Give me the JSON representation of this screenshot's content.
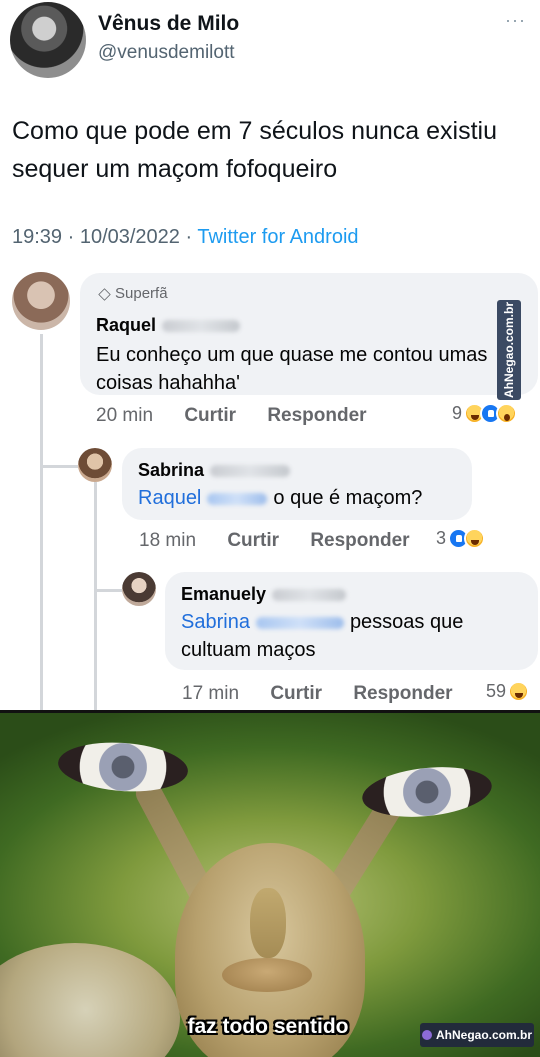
{
  "tweet": {
    "author_name": "Vênus de Milo",
    "author_handle": "@venusdemilott",
    "text": "Como que pode em 7 séculos nunca existiu sequer um maçom fofoqueiro",
    "timestamp": "19:39 · 10/03/2022 · ",
    "source": "Twitter for Android",
    "more_icon": "···"
  },
  "comments": [
    {
      "badge": "Superfã",
      "name": "Raquel",
      "text": "Eu conheço um que quase me contou umas coisas hahahha'",
      "time": "20 min",
      "like_label": "Curtir",
      "reply_label": "Responder",
      "reaction_count": "9",
      "reactions": [
        "haha-icon",
        "like-icon",
        "wow-icon"
      ]
    },
    {
      "name": "Sabrina",
      "mention": "Raquel",
      "text": "o que é maçom?",
      "time": "18 min",
      "like_label": "Curtir",
      "reply_label": "Responder",
      "reaction_count": "3",
      "reactions": [
        "like-icon",
        "haha-icon"
      ]
    },
    {
      "name": "Emanuely",
      "mention": "Sabrina",
      "text": "pessoas que cultuam maços",
      "time": "17 min",
      "like_label": "Curtir",
      "reply_label": "Responder",
      "reaction_count": "59",
      "reactions": [
        "haha-icon"
      ]
    }
  ],
  "watermark_vertical": "AhNegao.com.br",
  "meme": {
    "caption": "faz todo sentido",
    "watermark": "AhNegao.com.br"
  },
  "colors": {
    "mention": "#216fdb",
    "twitter_blue": "#1d9bf0",
    "bubble": "#f0f2f5"
  }
}
